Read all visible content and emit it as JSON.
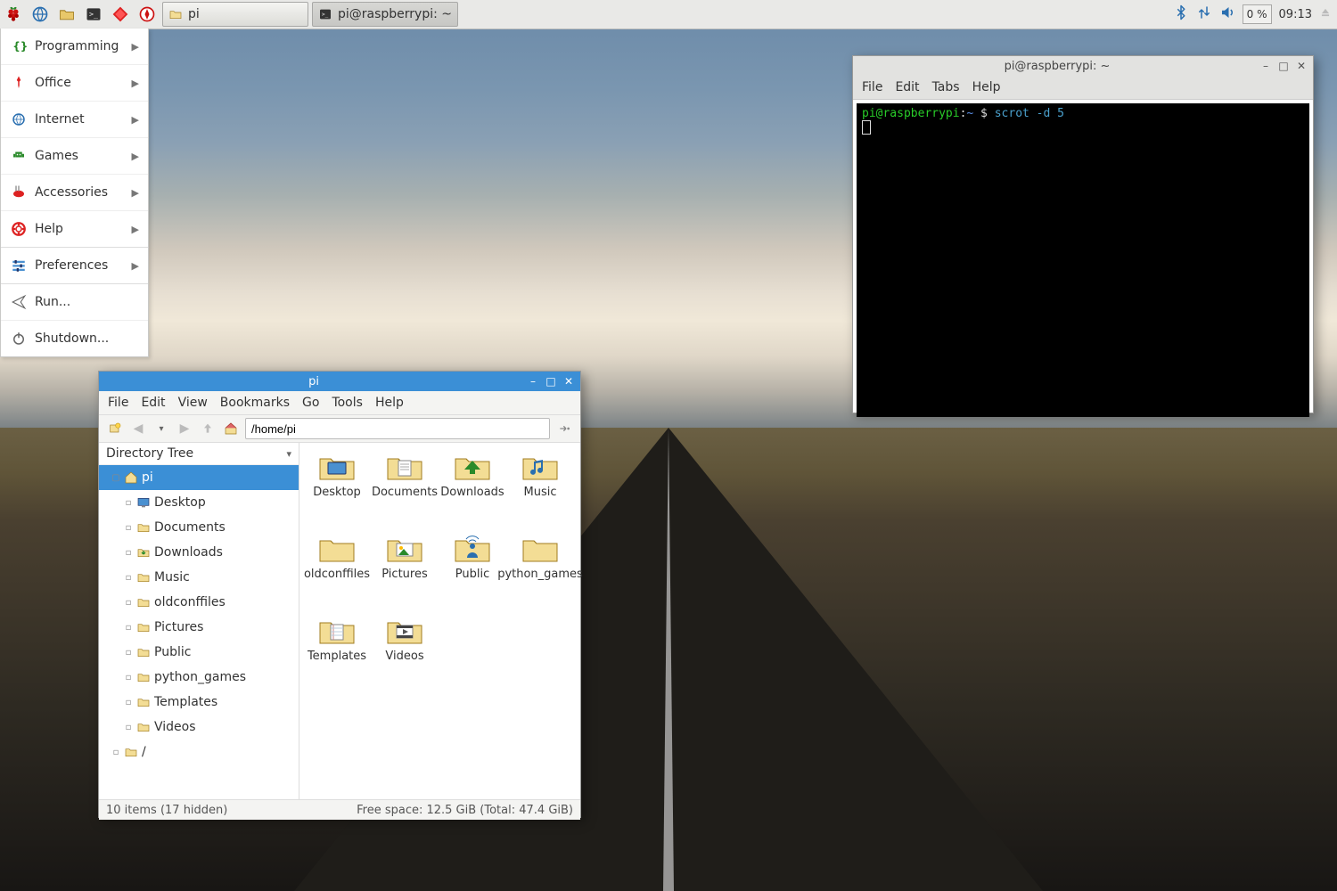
{
  "panel": {
    "task_buttons": [
      {
        "icon": "folder",
        "label": "pi"
      },
      {
        "icon": "terminal",
        "label": "pi@raspberrypi: ~"
      }
    ],
    "cpu": "0 %",
    "clock": "09:13"
  },
  "start_menu": {
    "items": [
      {
        "label": "Programming",
        "arrow": true,
        "icon": "braces"
      },
      {
        "label": "Office",
        "arrow": true,
        "icon": "pin"
      },
      {
        "label": "Internet",
        "arrow": true,
        "icon": "globe"
      },
      {
        "label": "Games",
        "arrow": true,
        "icon": "alien"
      },
      {
        "label": "Accessories",
        "arrow": true,
        "icon": "swiss"
      },
      {
        "label": "Help",
        "arrow": true,
        "icon": "lifebuoy"
      }
    ],
    "items2": [
      {
        "label": "Preferences",
        "arrow": true,
        "icon": "sliders"
      }
    ],
    "items3": [
      {
        "label": "Run...",
        "arrow": false,
        "icon": "send"
      },
      {
        "label": "Shutdown...",
        "arrow": false,
        "icon": "power"
      }
    ]
  },
  "file_manager": {
    "title": "pi",
    "menus": [
      "File",
      "Edit",
      "View",
      "Bookmarks",
      "Go",
      "Tools",
      "Help"
    ],
    "path": "/home/pi",
    "tree_header": "Directory Tree",
    "tree_root": "pi",
    "tree_children": [
      "Desktop",
      "Documents",
      "Downloads",
      "Music",
      "oldconffiles",
      "Pictures",
      "Public",
      "python_games",
      "Templates",
      "Videos"
    ],
    "tree_slash": "/",
    "folders": [
      "Desktop",
      "Documents",
      "Downloads",
      "Music",
      "oldconffiles",
      "Pictures",
      "Public",
      "python_games",
      "Templates",
      "Videos"
    ],
    "status_left": "10 items (17 hidden)",
    "status_right": "Free space: 12.5 GiB (Total: 47.4 GiB)"
  },
  "terminal": {
    "title": "pi@raspberrypi: ~",
    "menus": [
      "File",
      "Edit",
      "Tabs",
      "Help"
    ],
    "prompt_user": "pi@raspberrypi",
    "prompt_path": "~",
    "prompt_sep": ":",
    "prompt_dollar": " $ ",
    "command": "scrot -d 5"
  }
}
